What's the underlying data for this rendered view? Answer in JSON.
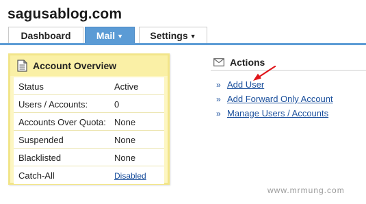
{
  "site": {
    "title": "sagusablog.com"
  },
  "nav": {
    "tabs": [
      {
        "label": "Dashboard",
        "caret": ""
      },
      {
        "label": "Mail",
        "caret": "▼"
      },
      {
        "label": "Settings",
        "caret": "▼"
      }
    ],
    "active_tab": "Mail"
  },
  "account_overview": {
    "title": "Account Overview",
    "icon": "document-icon",
    "rows": [
      {
        "label": "Status",
        "value": "Active"
      },
      {
        "label": "Users / Accounts:",
        "value": "0"
      },
      {
        "label": "Accounts Over Quota:",
        "value": "None"
      },
      {
        "label": "Suspended",
        "value": "None"
      },
      {
        "label": "Blacklisted",
        "value": "None"
      },
      {
        "label": "Catch-All",
        "value": "Disabled"
      }
    ]
  },
  "actions": {
    "title": "Actions",
    "icon": "envelope-icon",
    "bullet": "»",
    "items": [
      {
        "label": "Add User"
      },
      {
        "label": "Add Forward Only Account"
      },
      {
        "label": "Manage Users / Accounts"
      }
    ]
  },
  "annotation": {
    "icon": "red-arrow-icon",
    "color": "#e0161b"
  },
  "watermark": "www.mrmung.com",
  "colors": {
    "tab_active": "#5b9bd5",
    "panel_bg": "#fdf6c2",
    "panel_border": "#f2e58a",
    "link": "#1a4f9c"
  }
}
